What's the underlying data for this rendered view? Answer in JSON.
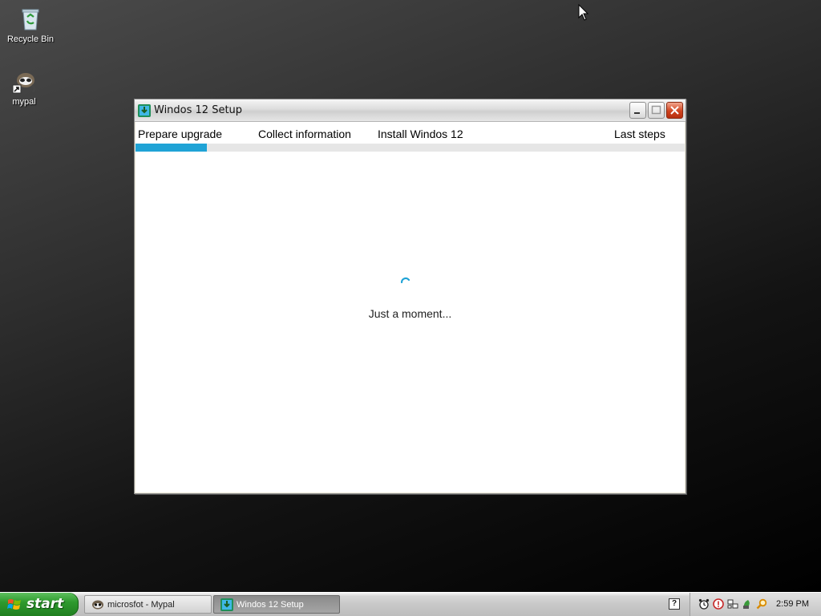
{
  "desktop": {
    "icons": [
      {
        "label": "Recycle Bin",
        "icon": "recycle-bin-icon"
      },
      {
        "label": "mypal",
        "icon": "raccoon-shortcut-icon"
      }
    ]
  },
  "window": {
    "title": "Windos 12 Setup",
    "icon": "setup-download-icon",
    "steps": [
      "Prepare upgrade",
      "Collect information",
      "Install Windos 12",
      "Last steps"
    ],
    "progress": 0.13,
    "status": "Just a moment...",
    "colors": {
      "accent": "#1fa3d6"
    }
  },
  "taskbar": {
    "start_label": "start",
    "tasks": [
      {
        "label": "microsfot - Mypal",
        "icon": "raccoon-icon",
        "active": false
      },
      {
        "label": "Windos 12 Setup",
        "icon": "setup-download-icon",
        "active": true
      }
    ],
    "help_glyph": "?",
    "tray_icons": [
      "alarm-clock-icon",
      "shield-alert-icon",
      "network-icon",
      "plant-icon",
      "search-icon"
    ],
    "clock": "2:59 PM"
  }
}
